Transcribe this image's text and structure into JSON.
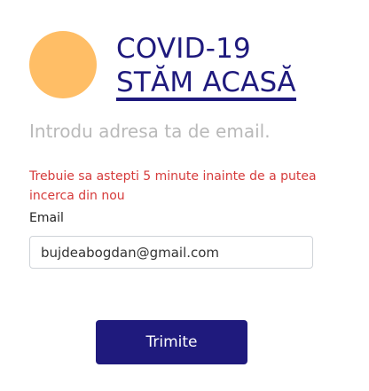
{
  "brand": {
    "line1": "COVID-19",
    "line2": "STĂM ACASĂ",
    "colors": {
      "primary": "#1f1a7d",
      "logo": "#ffbe66"
    }
  },
  "form": {
    "subtitle": "Introdu adresa ta de email.",
    "error": "Trebuie sa astepti 5 minute inainte de a putea incerca din nou",
    "email_label": "Email",
    "email_value": "bujdeabogdan@gmail.com",
    "submit_label": "Trimite",
    "error_color": "#d63b3b"
  }
}
